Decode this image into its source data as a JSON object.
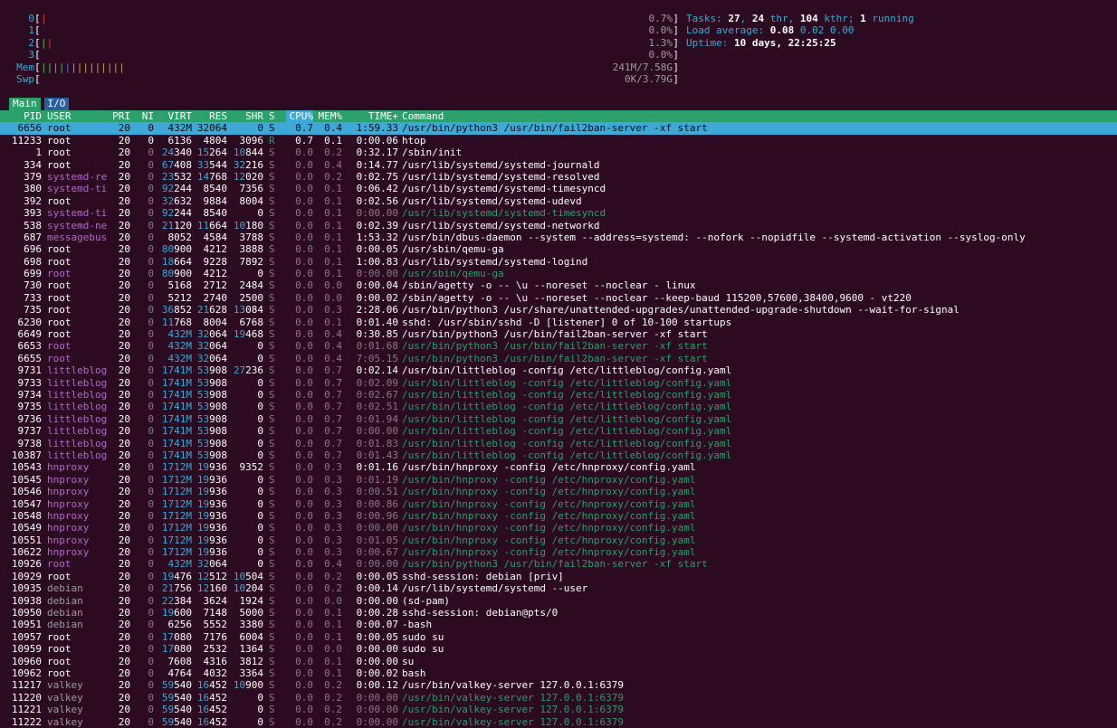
{
  "meters": [
    {
      "label": "0",
      "bars": [
        {
          "t": "|",
          "c": "red"
        }
      ],
      "value": "0.7%"
    },
    {
      "label": "1",
      "bars": [],
      "value": "0.0%"
    },
    {
      "label": "2",
      "bars": [
        {
          "t": "|",
          "c": "green"
        },
        {
          "t": "|",
          "c": "red"
        }
      ],
      "value": "1.3%"
    },
    {
      "label": "3",
      "bars": [],
      "value": "0.0%"
    },
    {
      "label": "Mem",
      "bars": [
        {
          "t": "||||",
          "c": "green"
        },
        {
          "t": "|",
          "c": "blue"
        },
        {
          "t": "|||||||||",
          "c": "yellow"
        }
      ],
      "value": "241M/7.58G"
    },
    {
      "label": "Swp",
      "bars": [],
      "value": "0K/3.79G"
    }
  ],
  "summary": {
    "tasks_label": "Tasks: ",
    "tasks": "27",
    "sep1": ", ",
    "thr": "24",
    "thr_label": " thr, ",
    "kthr": "104",
    "kthr_label": " kthr; ",
    "running": "1",
    "running_label": " running",
    "load_label": "Load average: ",
    "load1": "0.08",
    "load5": "0.02",
    "load15": "0.00",
    "uptime_label": "Uptime: ",
    "uptime": "10 days, 22:25:25"
  },
  "tabs": [
    {
      "label": "Main"
    },
    {
      "label": "I/O"
    }
  ],
  "columns": {
    "pid": "PID",
    "user": "USER",
    "pri": "PRI",
    "ni": "NI",
    "virt": "VIRT",
    "res": "RES",
    "shr": "SHR",
    "s": "S",
    "cpu": "CPU%",
    "mem": "MEM%",
    "time": "TIME+",
    "command": "Command"
  },
  "colors": {
    "background": "#2c0a22",
    "header_bar": "#2aa06a",
    "selection": "#3ea8d6",
    "accent_cyan": "#3ea8d6",
    "user_purple": "#b468c8",
    "thread_green": "#2aa06a"
  },
  "processes": [
    {
      "pid": "6656",
      "user": "root",
      "pri": "20",
      "ni": "0",
      "virt": "432M",
      "res": "32064",
      "shr": "0",
      "s": "S",
      "cpu": "0.7",
      "mem": "0.4",
      "time": "1:59.33",
      "cmd": "/usr/bin/python3 /usr/bin/fail2ban-server -xf start",
      "kind": "sel"
    },
    {
      "pid": "11233",
      "user": "root",
      "pri": "20",
      "ni": "0",
      "virt": "6136",
      "res": "4804",
      "shr": "3096",
      "s": "R",
      "cpu": "0.7",
      "mem": "0.1",
      "time": "0:00.06",
      "cmd": "htop",
      "kind": "proc"
    },
    {
      "pid": "1",
      "user": "root",
      "pri": "20",
      "ni": "0",
      "virt": "24340",
      "res": "15264",
      "shr": "10844",
      "s": "S",
      "cpu": "0.0",
      "mem": "0.2",
      "time": "0:32.17",
      "cmd": "/sbin/init",
      "kind": "proc"
    },
    {
      "pid": "334",
      "user": "root",
      "pri": "20",
      "ni": "0",
      "virt": "67408",
      "res": "33544",
      "shr": "32216",
      "s": "S",
      "cpu": "0.0",
      "mem": "0.4",
      "time": "0:14.77",
      "cmd": "/usr/lib/systemd/systemd-journald",
      "kind": "proc"
    },
    {
      "pid": "379",
      "user": "systemd-re",
      "pri": "20",
      "ni": "0",
      "virt": "23532",
      "res": "14768",
      "shr": "12020",
      "s": "S",
      "cpu": "0.0",
      "mem": "0.2",
      "time": "0:02.75",
      "cmd": "/usr/lib/systemd/systemd-resolved",
      "kind": "proc",
      "uc": "purple"
    },
    {
      "pid": "380",
      "user": "systemd-ti",
      "pri": "20",
      "ni": "0",
      "virt": "92244",
      "res": "8540",
      "shr": "7356",
      "s": "S",
      "cpu": "0.0",
      "mem": "0.1",
      "time": "0:06.42",
      "cmd": "/usr/lib/systemd/systemd-timesyncd",
      "kind": "proc",
      "uc": "purple"
    },
    {
      "pid": "392",
      "user": "root",
      "pri": "20",
      "ni": "0",
      "virt": "32632",
      "res": "9884",
      "shr": "8004",
      "s": "S",
      "cpu": "0.0",
      "mem": "0.1",
      "time": "0:02.56",
      "cmd": "/usr/lib/systemd/systemd-udevd",
      "kind": "proc"
    },
    {
      "pid": "393",
      "user": "systemd-ti",
      "pri": "20",
      "ni": "0",
      "virt": "92244",
      "res": "8540",
      "shr": "0",
      "s": "S",
      "cpu": "0.0",
      "mem": "0.1",
      "time": "0:00.00",
      "cmd": "/usr/lib/systemd/systemd-timesyncd",
      "kind": "thr",
      "uc": "purple"
    },
    {
      "pid": "538",
      "user": "systemd-ne",
      "pri": "20",
      "ni": "0",
      "virt": "21120",
      "res": "11664",
      "shr": "10180",
      "s": "S",
      "cpu": "0.0",
      "mem": "0.1",
      "time": "0:02.39",
      "cmd": "/usr/lib/systemd/systemd-networkd",
      "kind": "proc",
      "uc": "purple"
    },
    {
      "pid": "687",
      "user": "messagebus",
      "pri": "20",
      "ni": "0",
      "virt": "8052",
      "res": "4584",
      "shr": "3788",
      "s": "S",
      "cpu": "0.0",
      "mem": "0.1",
      "time": "1:53.32",
      "cmd": "/usr/bin/dbus-daemon --system --address=systemd: --nofork --nopidfile --systemd-activation --syslog-only",
      "kind": "proc",
      "uc": "purple"
    },
    {
      "pid": "696",
      "user": "root",
      "pri": "20",
      "ni": "0",
      "virt": "80900",
      "res": "4212",
      "shr": "3888",
      "s": "S",
      "cpu": "0.0",
      "mem": "0.1",
      "time": "0:00.05",
      "cmd": "/usr/sbin/qemu-ga",
      "kind": "proc"
    },
    {
      "pid": "698",
      "user": "root",
      "pri": "20",
      "ni": "0",
      "virt": "18664",
      "res": "9228",
      "shr": "7892",
      "s": "S",
      "cpu": "0.0",
      "mem": "0.1",
      "time": "1:00.83",
      "cmd": "/usr/lib/systemd/systemd-logind",
      "kind": "proc"
    },
    {
      "pid": "699",
      "user": "root",
      "pri": "20",
      "ni": "0",
      "virt": "80900",
      "res": "4212",
      "shr": "0",
      "s": "S",
      "cpu": "0.0",
      "mem": "0.1",
      "time": "0:00.00",
      "cmd": "/usr/sbin/qemu-ga",
      "kind": "thr",
      "uc": "purple"
    },
    {
      "pid": "730",
      "user": "root",
      "pri": "20",
      "ni": "0",
      "virt": "5168",
      "res": "2712",
      "shr": "2484",
      "s": "S",
      "cpu": "0.0",
      "mem": "0.0",
      "time": "0:00.04",
      "cmd": "/sbin/agetty -o -- \\u --noreset --noclear - linux",
      "kind": "proc"
    },
    {
      "pid": "733",
      "user": "root",
      "pri": "20",
      "ni": "0",
      "virt": "5212",
      "res": "2740",
      "shr": "2500",
      "s": "S",
      "cpu": "0.0",
      "mem": "0.0",
      "time": "0:00.02",
      "cmd": "/sbin/agetty -o -- \\u --noreset --noclear --keep-baud 115200,57600,38400,9600 - vt220",
      "kind": "proc"
    },
    {
      "pid": "735",
      "user": "root",
      "pri": "20",
      "ni": "0",
      "virt": "36852",
      "res": "21628",
      "shr": "13084",
      "s": "S",
      "cpu": "0.0",
      "mem": "0.3",
      "time": "2:28.06",
      "cmd": "/usr/bin/python3 /usr/share/unattended-upgrades/unattended-upgrade-shutdown --wait-for-signal",
      "kind": "proc"
    },
    {
      "pid": "6230",
      "user": "root",
      "pri": "20",
      "ni": "0",
      "virt": "11768",
      "res": "8004",
      "shr": "6768",
      "s": "S",
      "cpu": "0.0",
      "mem": "0.1",
      "time": "0:01.40",
      "cmd": "sshd: /usr/sbin/sshd -D [listener] 0 of 10-100 startups",
      "kind": "proc"
    },
    {
      "pid": "6649",
      "user": "root",
      "pri": "20",
      "ni": "0",
      "virt": "432M",
      "res": "32064",
      "shr": "19468",
      "s": "S",
      "cpu": "0.0",
      "mem": "0.4",
      "time": "0:30.85",
      "cmd": "/usr/bin/python3 /usr/bin/fail2ban-server -xf start",
      "kind": "proc"
    },
    {
      "pid": "6653",
      "user": "root",
      "pri": "20",
      "ni": "0",
      "virt": "432M",
      "res": "32064",
      "shr": "0",
      "s": "S",
      "cpu": "0.0",
      "mem": "0.4",
      "time": "0:01.68",
      "cmd": "/usr/bin/python3 /usr/bin/fail2ban-server -xf start",
      "kind": "thr",
      "uc": "purple"
    },
    {
      "pid": "6655",
      "user": "root",
      "pri": "20",
      "ni": "0",
      "virt": "432M",
      "res": "32064",
      "shr": "0",
      "s": "S",
      "cpu": "0.0",
      "mem": "0.4",
      "time": "7:05.15",
      "cmd": "/usr/bin/python3 /usr/bin/fail2ban-server -xf start",
      "kind": "thr",
      "uc": "purple"
    },
    {
      "pid": "9731",
      "user": "littleblog",
      "pri": "20",
      "ni": "0",
      "virt": "1741M",
      "res": "53908",
      "shr": "27236",
      "s": "S",
      "cpu": "0.0",
      "mem": "0.7",
      "time": "0:02.14",
      "cmd": "/usr/bin/littleblog -config /etc/littleblog/config.yaml",
      "kind": "proc",
      "uc": "purple"
    },
    {
      "pid": "9733",
      "user": "littleblog",
      "pri": "20",
      "ni": "0",
      "virt": "1741M",
      "res": "53908",
      "shr": "0",
      "s": "S",
      "cpu": "0.0",
      "mem": "0.7",
      "time": "0:02.09",
      "cmd": "/usr/bin/littleblog -config /etc/littleblog/config.yaml",
      "kind": "thr",
      "uc": "purple"
    },
    {
      "pid": "9734",
      "user": "littleblog",
      "pri": "20",
      "ni": "0",
      "virt": "1741M",
      "res": "53908",
      "shr": "0",
      "s": "S",
      "cpu": "0.0",
      "mem": "0.7",
      "time": "0:02.67",
      "cmd": "/usr/bin/littleblog -config /etc/littleblog/config.yaml",
      "kind": "thr",
      "uc": "purple"
    },
    {
      "pid": "9735",
      "user": "littleblog",
      "pri": "20",
      "ni": "0",
      "virt": "1741M",
      "res": "53908",
      "shr": "0",
      "s": "S",
      "cpu": "0.0",
      "mem": "0.7",
      "time": "0:02.51",
      "cmd": "/usr/bin/littleblog -config /etc/littleblog/config.yaml",
      "kind": "thr",
      "uc": "purple"
    },
    {
      "pid": "9736",
      "user": "littleblog",
      "pri": "20",
      "ni": "0",
      "virt": "1741M",
      "res": "53908",
      "shr": "0",
      "s": "S",
      "cpu": "0.0",
      "mem": "0.7",
      "time": "0:01.94",
      "cmd": "/usr/bin/littleblog -config /etc/littleblog/config.yaml",
      "kind": "thr",
      "uc": "purple"
    },
    {
      "pid": "9737",
      "user": "littleblog",
      "pri": "20",
      "ni": "0",
      "virt": "1741M",
      "res": "53908",
      "shr": "0",
      "s": "S",
      "cpu": "0.0",
      "mem": "0.7",
      "time": "0:00.00",
      "cmd": "/usr/bin/littleblog -config /etc/littleblog/config.yaml",
      "kind": "thr",
      "uc": "purple"
    },
    {
      "pid": "9738",
      "user": "littleblog",
      "pri": "20",
      "ni": "0",
      "virt": "1741M",
      "res": "53908",
      "shr": "0",
      "s": "S",
      "cpu": "0.0",
      "mem": "0.7",
      "time": "0:01.83",
      "cmd": "/usr/bin/littleblog -config /etc/littleblog/config.yaml",
      "kind": "thr",
      "uc": "purple"
    },
    {
      "pid": "10387",
      "user": "littleblog",
      "pri": "20",
      "ni": "0",
      "virt": "1741M",
      "res": "53908",
      "shr": "0",
      "s": "S",
      "cpu": "0.0",
      "mem": "0.7",
      "time": "0:01.43",
      "cmd": "/usr/bin/littleblog -config /etc/littleblog/config.yaml",
      "kind": "thr",
      "uc": "purple"
    },
    {
      "pid": "10543",
      "user": "hnproxy",
      "pri": "20",
      "ni": "0",
      "virt": "1712M",
      "res": "19936",
      "shr": "9352",
      "s": "S",
      "cpu": "0.0",
      "mem": "0.3",
      "time": "0:01.16",
      "cmd": "/usr/bin/hnproxy -config /etc/hnproxy/config.yaml",
      "kind": "proc",
      "uc": "purple"
    },
    {
      "pid": "10545",
      "user": "hnproxy",
      "pri": "20",
      "ni": "0",
      "virt": "1712M",
      "res": "19936",
      "shr": "0",
      "s": "S",
      "cpu": "0.0",
      "mem": "0.3",
      "time": "0:01.19",
      "cmd": "/usr/bin/hnproxy -config /etc/hnproxy/config.yaml",
      "kind": "thr",
      "uc": "purple"
    },
    {
      "pid": "10546",
      "user": "hnproxy",
      "pri": "20",
      "ni": "0",
      "virt": "1712M",
      "res": "19936",
      "shr": "0",
      "s": "S",
      "cpu": "0.0",
      "mem": "0.3",
      "time": "0:00.51",
      "cmd": "/usr/bin/hnproxy -config /etc/hnproxy/config.yaml",
      "kind": "thr",
      "uc": "purple"
    },
    {
      "pid": "10547",
      "user": "hnproxy",
      "pri": "20",
      "ni": "0",
      "virt": "1712M",
      "res": "19936",
      "shr": "0",
      "s": "S",
      "cpu": "0.0",
      "mem": "0.3",
      "time": "0:00.86",
      "cmd": "/usr/bin/hnproxy -config /etc/hnproxy/config.yaml",
      "kind": "thr",
      "uc": "purple"
    },
    {
      "pid": "10548",
      "user": "hnproxy",
      "pri": "20",
      "ni": "0",
      "virt": "1712M",
      "res": "19936",
      "shr": "0",
      "s": "S",
      "cpu": "0.0",
      "mem": "0.3",
      "time": "0:00.96",
      "cmd": "/usr/bin/hnproxy -config /etc/hnproxy/config.yaml",
      "kind": "thr",
      "uc": "purple"
    },
    {
      "pid": "10549",
      "user": "hnproxy",
      "pri": "20",
      "ni": "0",
      "virt": "1712M",
      "res": "19936",
      "shr": "0",
      "s": "S",
      "cpu": "0.0",
      "mem": "0.3",
      "time": "0:00.00",
      "cmd": "/usr/bin/hnproxy -config /etc/hnproxy/config.yaml",
      "kind": "thr",
      "uc": "purple"
    },
    {
      "pid": "10551",
      "user": "hnproxy",
      "pri": "20",
      "ni": "0",
      "virt": "1712M",
      "res": "19936",
      "shr": "0",
      "s": "S",
      "cpu": "0.0",
      "mem": "0.3",
      "time": "0:01.05",
      "cmd": "/usr/bin/hnproxy -config /etc/hnproxy/config.yaml",
      "kind": "thr",
      "uc": "purple"
    },
    {
      "pid": "10622",
      "user": "hnproxy",
      "pri": "20",
      "ni": "0",
      "virt": "1712M",
      "res": "19936",
      "shr": "0",
      "s": "S",
      "cpu": "0.0",
      "mem": "0.3",
      "time": "0:00.67",
      "cmd": "/usr/bin/hnproxy -config /etc/hnproxy/config.yaml",
      "kind": "thr",
      "uc": "purple"
    },
    {
      "pid": "10926",
      "user": "root",
      "pri": "20",
      "ni": "0",
      "virt": "432M",
      "res": "32064",
      "shr": "0",
      "s": "S",
      "cpu": "0.0",
      "mem": "0.4",
      "time": "0:00.00",
      "cmd": "/usr/bin/python3 /usr/bin/fail2ban-server -xf start",
      "kind": "thr",
      "uc": "purple"
    },
    {
      "pid": "10929",
      "user": "root",
      "pri": "20",
      "ni": "0",
      "virt": "19476",
      "res": "12512",
      "shr": "10504",
      "s": "S",
      "cpu": "0.0",
      "mem": "0.2",
      "time": "0:00.05",
      "cmd": "sshd-session: debian [priv]",
      "kind": "proc"
    },
    {
      "pid": "10935",
      "user": "debian",
      "pri": "20",
      "ni": "0",
      "virt": "21756",
      "res": "12160",
      "shr": "10204",
      "s": "S",
      "cpu": "0.0",
      "mem": "0.2",
      "time": "0:00.14",
      "cmd": "/usr/lib/systemd/systemd --user",
      "kind": "proc",
      "uc": "gray"
    },
    {
      "pid": "10938",
      "user": "debian",
      "pri": "20",
      "ni": "0",
      "virt": "22384",
      "res": "3624",
      "shr": "1924",
      "s": "S",
      "cpu": "0.0",
      "mem": "0.0",
      "time": "0:00.00",
      "cmd": "(sd-pam)",
      "kind": "proc",
      "uc": "gray"
    },
    {
      "pid": "10950",
      "user": "debian",
      "pri": "20",
      "ni": "0",
      "virt": "19600",
      "res": "7148",
      "shr": "5000",
      "s": "S",
      "cpu": "0.0",
      "mem": "0.1",
      "time": "0:00.28",
      "cmd": "sshd-session: debian@pts/0",
      "kind": "proc",
      "uc": "gray"
    },
    {
      "pid": "10951",
      "user": "debian",
      "pri": "20",
      "ni": "0",
      "virt": "6256",
      "res": "5552",
      "shr": "3380",
      "s": "S",
      "cpu": "0.0",
      "mem": "0.1",
      "time": "0:00.07",
      "cmd": "-bash",
      "kind": "proc",
      "uc": "gray"
    },
    {
      "pid": "10957",
      "user": "root",
      "pri": "20",
      "ni": "0",
      "virt": "17080",
      "res": "7176",
      "shr": "6004",
      "s": "S",
      "cpu": "0.0",
      "mem": "0.1",
      "time": "0:00.05",
      "cmd": "sudo su",
      "kind": "proc"
    },
    {
      "pid": "10959",
      "user": "root",
      "pri": "20",
      "ni": "0",
      "virt": "17080",
      "res": "2532",
      "shr": "1364",
      "s": "S",
      "cpu": "0.0",
      "mem": "0.0",
      "time": "0:00.00",
      "cmd": "sudo su",
      "kind": "proc"
    },
    {
      "pid": "10960",
      "user": "root",
      "pri": "20",
      "ni": "0",
      "virt": "7608",
      "res": "4316",
      "shr": "3812",
      "s": "S",
      "cpu": "0.0",
      "mem": "0.1",
      "time": "0:00.00",
      "cmd": "su",
      "kind": "proc"
    },
    {
      "pid": "10962",
      "user": "root",
      "pri": "20",
      "ni": "0",
      "virt": "4764",
      "res": "4032",
      "shr": "3364",
      "s": "S",
      "cpu": "0.0",
      "mem": "0.1",
      "time": "0:00.02",
      "cmd": "bash",
      "kind": "proc"
    },
    {
      "pid": "11217",
      "user": "valkey",
      "pri": "20",
      "ni": "0",
      "virt": "59540",
      "res": "16452",
      "shr": "10900",
      "s": "S",
      "cpu": "0.0",
      "mem": "0.2",
      "time": "0:00.12",
      "cmd": "/usr/bin/valkey-server 127.0.0.1:6379",
      "kind": "proc",
      "uc": "gray"
    },
    {
      "pid": "11220",
      "user": "valkey",
      "pri": "20",
      "ni": "0",
      "virt": "59540",
      "res": "16452",
      "shr": "0",
      "s": "S",
      "cpu": "0.0",
      "mem": "0.2",
      "time": "0:00.00",
      "cmd": "/usr/bin/valkey-server 127.0.0.1:6379",
      "kind": "thr",
      "uc": "gray"
    },
    {
      "pid": "11221",
      "user": "valkey",
      "pri": "20",
      "ni": "0",
      "virt": "59540",
      "res": "16452",
      "shr": "0",
      "s": "S",
      "cpu": "0.0",
      "mem": "0.2",
      "time": "0:00.00",
      "cmd": "/usr/bin/valkey-server 127.0.0.1:6379",
      "kind": "thr",
      "uc": "gray"
    },
    {
      "pid": "11222",
      "user": "valkey",
      "pri": "20",
      "ni": "0",
      "virt": "59540",
      "res": "16452",
      "shr": "0",
      "s": "S",
      "cpu": "0.0",
      "mem": "0.2",
      "time": "0:00.00",
      "cmd": "/usr/bin/valkey-server 127.0.0.1:6379",
      "kind": "thr",
      "uc": "gray"
    }
  ]
}
